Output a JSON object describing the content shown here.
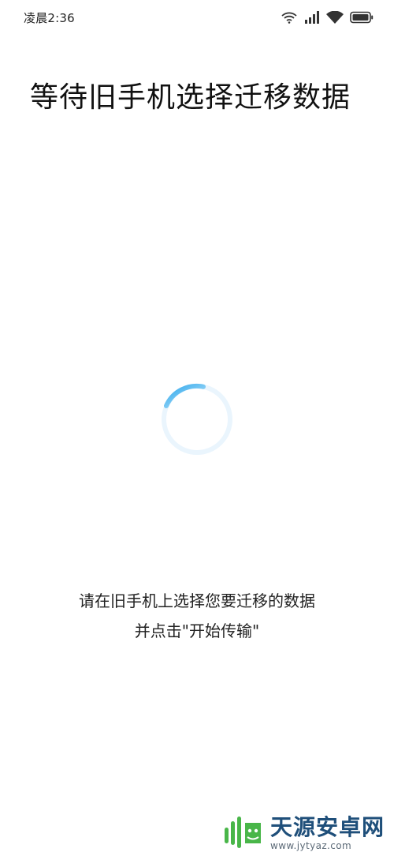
{
  "status_bar": {
    "time": "凌晨2:36",
    "icons": [
      "hotspot-icon",
      "signal-icon",
      "wifi-icon",
      "battery-icon"
    ]
  },
  "main": {
    "title": "等待旧手机选择迁移数据",
    "instruction_line1": "请在旧手机上选择您要迁移的数据",
    "instruction_line2": "并点击\"开始传输\""
  },
  "spinner": {
    "accent_color": "#3fb1ef",
    "track_color": "#eaf5fd"
  },
  "watermark": {
    "name": "天源安卓网",
    "url": "www.jytyaz.com",
    "logo_color": "#49b649"
  }
}
